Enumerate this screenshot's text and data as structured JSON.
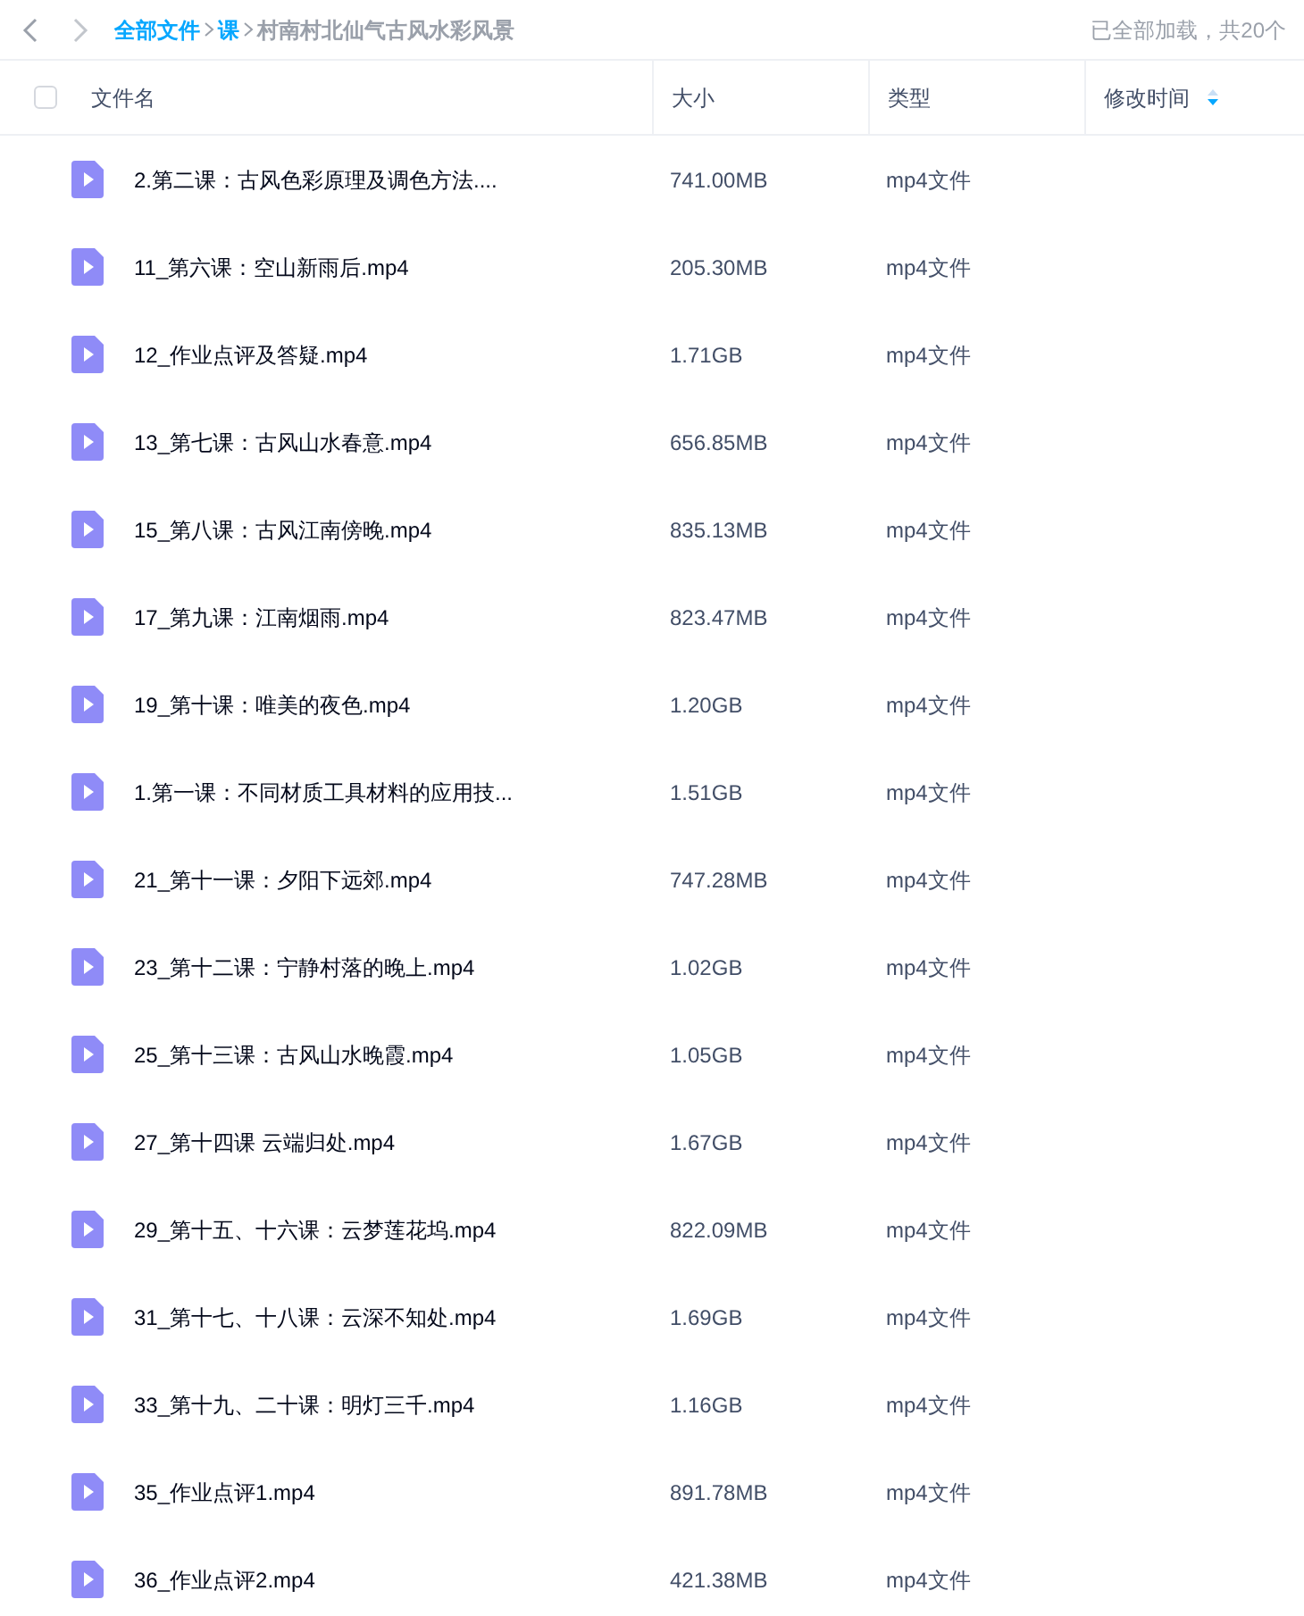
{
  "toolbar": {
    "breadcrumb": [
      {
        "label": "全部文件",
        "kind": "link"
      },
      {
        "label": "课",
        "kind": "link"
      },
      {
        "label": "村南村北仙气古风水彩风景",
        "kind": "current"
      }
    ],
    "load_status": "已全部加载，共20个"
  },
  "table": {
    "select_all": {
      "checked": false
    },
    "columns": [
      {
        "label": "文件名",
        "sortable": false
      },
      {
        "label": "大小",
        "sortable": false
      },
      {
        "label": "类型",
        "sortable": false
      },
      {
        "label": "修改时间",
        "sortable": true
      }
    ],
    "rows": [
      {
        "name": "2.第二课：古风色彩原理及调色方法....",
        "size": "741.00MB",
        "type": "mp4文件"
      },
      {
        "name": "11_第六课：空山新雨后.mp4",
        "size": "205.30MB",
        "type": "mp4文件"
      },
      {
        "name": "12_作业点评及答疑.mp4",
        "size": "1.71GB",
        "type": "mp4文件"
      },
      {
        "name": "13_第七课：古风山水春意.mp4",
        "size": "656.85MB",
        "type": "mp4文件"
      },
      {
        "name": "15_第八课：古风江南傍晚.mp4",
        "size": "835.13MB",
        "type": "mp4文件"
      },
      {
        "name": "17_第九课：江南烟雨.mp4",
        "size": "823.47MB",
        "type": "mp4文件"
      },
      {
        "name": "19_第十课：唯美的夜色.mp4",
        "size": "1.20GB",
        "type": "mp4文件"
      },
      {
        "name": "1.第一课：不同材质工具材料的应用技...",
        "size": "1.51GB",
        "type": "mp4文件"
      },
      {
        "name": "21_第十一课：夕阳下远郊.mp4",
        "size": "747.28MB",
        "type": "mp4文件"
      },
      {
        "name": "23_第十二课：宁静村落的晚上.mp4",
        "size": "1.02GB",
        "type": "mp4文件"
      },
      {
        "name": "25_第十三课：古风山水晚霞.mp4",
        "size": "1.05GB",
        "type": "mp4文件"
      },
      {
        "name": "27_第十四课 云端归处.mp4",
        "size": "1.67GB",
        "type": "mp4文件"
      },
      {
        "name": "29_第十五、十六课：云梦莲花坞.mp4",
        "size": "822.09MB",
        "type": "mp4文件"
      },
      {
        "name": "31_第十七、十八课：云深不知处.mp4",
        "size": "1.69GB",
        "type": "mp4文件"
      },
      {
        "name": "33_第十九、二十课：明灯三千.mp4",
        "size": "1.16GB",
        "type": "mp4文件"
      },
      {
        "name": "35_作业点评1.mp4",
        "size": "891.78MB",
        "type": "mp4文件"
      },
      {
        "name": "36_作业点评2.mp4",
        "size": "421.38MB",
        "type": "mp4文件"
      }
    ]
  }
}
